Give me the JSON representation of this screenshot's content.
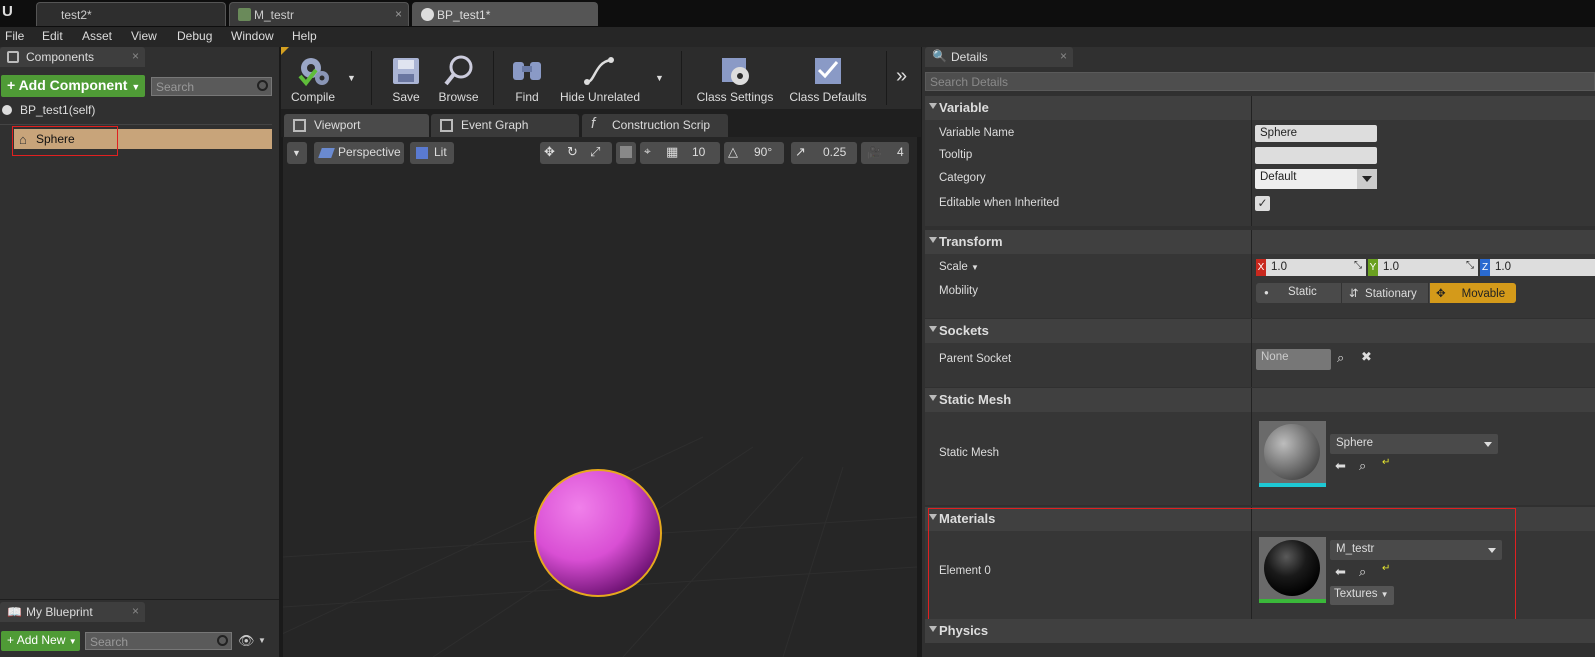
{
  "tabs": [
    {
      "label": "test2*"
    },
    {
      "label": "M_testr"
    },
    {
      "label": "BP_test1*"
    }
  ],
  "menu": [
    "File",
    "Edit",
    "Asset",
    "View",
    "Debug",
    "Window",
    "Help"
  ],
  "components_panel": {
    "tab_label": "Components",
    "add_component_label": "Add Component",
    "search_placeholder": "Search",
    "root_label": "BP_test1(self)",
    "selected_item": "Sphere"
  },
  "my_blueprint_panel": {
    "tab_label": "My Blueprint",
    "add_new_label": "Add New",
    "search_placeholder": "Search"
  },
  "toolbar": {
    "compile": "Compile",
    "save": "Save",
    "browse": "Browse",
    "find": "Find",
    "hide_unrelated": "Hide Unrelated",
    "class_settings": "Class Settings",
    "class_defaults": "Class Defaults"
  },
  "editor_tabs": [
    "Viewport",
    "Event Graph",
    "Construction Scrip"
  ],
  "viewport": {
    "perspective_label": "Perspective",
    "lit_label": "Lit",
    "grid_snap": "10",
    "rotation_snap": "90°",
    "scale_snap": "0.25",
    "camera_speed": "4",
    "sphere_color": "#d94fd4"
  },
  "details": {
    "tab_label": "Details",
    "search_placeholder": "Search Details",
    "variable": {
      "header": "Variable",
      "variable_name_label": "Variable Name",
      "variable_name_value": "Sphere",
      "tooltip_label": "Tooltip",
      "tooltip_value": "",
      "category_label": "Category",
      "category_value": "Default",
      "editable_label": "Editable when Inherited",
      "editable_checked": true
    },
    "transform": {
      "header": "Transform",
      "scale_label": "Scale",
      "scale_x": "1.0",
      "scale_y": "1.0",
      "scale_z": "1.0",
      "axis_x": "X",
      "axis_y": "Y",
      "axis_z": "Z",
      "mobility_label": "Mobility",
      "mobility_options": [
        "Static",
        "Stationary",
        "Movable"
      ],
      "mobility_selected": "Movable"
    },
    "sockets": {
      "header": "Sockets",
      "parent_socket_label": "Parent Socket",
      "parent_socket_value": "None"
    },
    "static_mesh": {
      "header": "Static Mesh",
      "label": "Static Mesh",
      "value": "Sphere"
    },
    "materials": {
      "header": "Materials",
      "element_label": "Element 0",
      "value": "M_testr",
      "textures_label": "Textures"
    },
    "physics": {
      "header": "Physics"
    }
  },
  "colors": {
    "accent_green": "#4f9b36",
    "highlight_red": "#e02020",
    "movable_orange": "#d49a1a",
    "selected_row": "#c8a47a"
  }
}
